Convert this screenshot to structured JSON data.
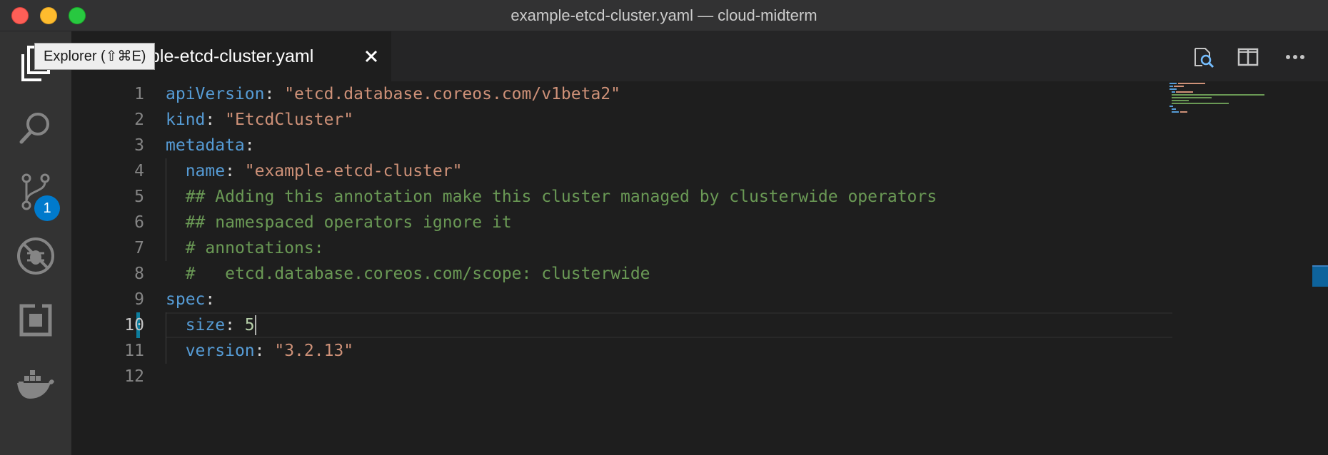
{
  "window": {
    "title": "example-etcd-cluster.yaml — cloud-midterm"
  },
  "activity_bar": {
    "items": [
      {
        "name": "explorer",
        "icon": "files-icon"
      },
      {
        "name": "search",
        "icon": "search-icon"
      },
      {
        "name": "source-control",
        "icon": "source-control-icon",
        "badge": "1"
      },
      {
        "name": "debug",
        "icon": "debug-icon"
      },
      {
        "name": "extensions",
        "icon": "extensions-icon"
      },
      {
        "name": "docker",
        "icon": "docker-icon"
      }
    ]
  },
  "tooltip": {
    "text": "Explorer (⇧⌘E)"
  },
  "tabs": [
    {
      "label": "example-etcd-cluster.yaml",
      "visible_label": "ple-etcd-cluster.yaml",
      "active": true,
      "close_icon": "close-icon"
    }
  ],
  "editor_actions": [
    {
      "name": "open-preview",
      "icon": "search-preview-icon"
    },
    {
      "name": "split-editor",
      "icon": "split-editor-icon"
    },
    {
      "name": "more-actions",
      "icon": "ellipsis-icon"
    }
  ],
  "editor": {
    "active_line": 10,
    "modified_line": 10,
    "line_numbers": [
      "1",
      "2",
      "3",
      "4",
      "5",
      "6",
      "7",
      "8",
      "9",
      "10",
      "11",
      "12"
    ],
    "lines": [
      {
        "tokens": [
          {
            "t": "k",
            "v": "apiVersion"
          },
          {
            "t": "p",
            "v": ": "
          },
          {
            "t": "s",
            "v": "\"etcd.database.coreos.com/v1beta2\""
          }
        ]
      },
      {
        "tokens": [
          {
            "t": "k",
            "v": "kind"
          },
          {
            "t": "p",
            "v": ": "
          },
          {
            "t": "s",
            "v": "\"EtcdCluster\""
          }
        ]
      },
      {
        "tokens": [
          {
            "t": "k",
            "v": "metadata"
          },
          {
            "t": "p",
            "v": ":"
          }
        ]
      },
      {
        "tokens": [
          {
            "t": "p",
            "v": "  "
          },
          {
            "t": "k",
            "v": "name"
          },
          {
            "t": "p",
            "v": ": "
          },
          {
            "t": "s",
            "v": "\"example-etcd-cluster\""
          }
        ]
      },
      {
        "tokens": [
          {
            "t": "p",
            "v": "  "
          },
          {
            "t": "c",
            "v": "## Adding this annotation make this cluster managed by clusterwide operators"
          }
        ]
      },
      {
        "tokens": [
          {
            "t": "p",
            "v": "  "
          },
          {
            "t": "c",
            "v": "## namespaced operators ignore it"
          }
        ]
      },
      {
        "tokens": [
          {
            "t": "p",
            "v": "  "
          },
          {
            "t": "c",
            "v": "# annotations:"
          }
        ]
      },
      {
        "tokens": [
          {
            "t": "p",
            "v": "  "
          },
          {
            "t": "c",
            "v": "#   etcd.database.coreos.com/scope: clusterwide"
          }
        ]
      },
      {
        "tokens": [
          {
            "t": "k",
            "v": "spec"
          },
          {
            "t": "p",
            "v": ":"
          }
        ]
      },
      {
        "tokens": [
          {
            "t": "p",
            "v": "  "
          },
          {
            "t": "k",
            "v": "size"
          },
          {
            "t": "p",
            "v": ": "
          },
          {
            "t": "n",
            "v": "5"
          }
        ]
      },
      {
        "tokens": [
          {
            "t": "p",
            "v": "  "
          },
          {
            "t": "k",
            "v": "version"
          },
          {
            "t": "p",
            "v": ": "
          },
          {
            "t": "s",
            "v": "\"3.2.13\""
          }
        ]
      },
      {
        "tokens": []
      }
    ]
  },
  "colors": {
    "keyword": "#569cd6",
    "string": "#ce9178",
    "number": "#b5cea8",
    "comment": "#6a9955",
    "badge": "#007acc",
    "modified": "#0c7d9d"
  }
}
